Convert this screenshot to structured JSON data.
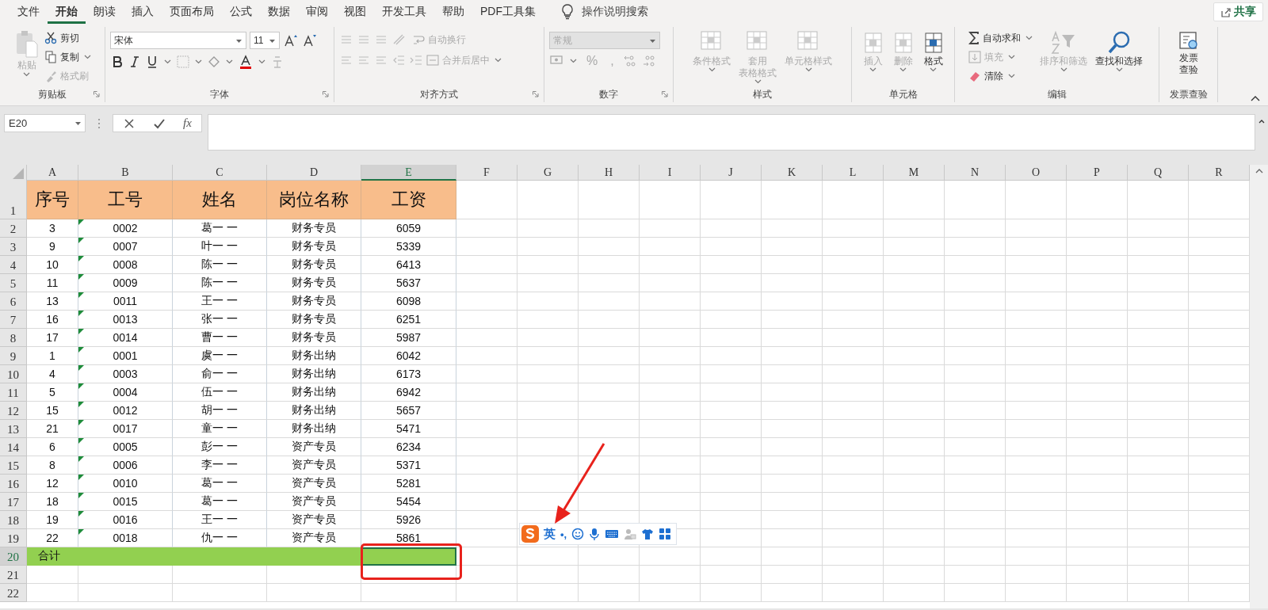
{
  "menu_tabs": [
    {
      "label": "文件",
      "selected": false
    },
    {
      "label": "开始",
      "selected": true
    },
    {
      "label": "朗读",
      "selected": false
    },
    {
      "label": "插入",
      "selected": false
    },
    {
      "label": "页面布局",
      "selected": false
    },
    {
      "label": "公式",
      "selected": false
    },
    {
      "label": "数据",
      "selected": false
    },
    {
      "label": "审阅",
      "selected": false
    },
    {
      "label": "视图",
      "selected": false
    },
    {
      "label": "开发工具",
      "selected": false
    },
    {
      "label": "帮助",
      "selected": false
    },
    {
      "label": "PDF工具集",
      "selected": false
    }
  ],
  "tell_me": "操作说明搜索",
  "share_button": "共享",
  "ribbon": {
    "clipboard": {
      "label": "剪贴板",
      "paste": "粘贴",
      "cut": "剪切",
      "copy": "复制",
      "format_painter": "格式刷"
    },
    "font": {
      "label": "字体",
      "font_name": "宋体",
      "font_size": "11"
    },
    "alignment": {
      "label": "对齐方式",
      "wrap": "自动换行",
      "merge": "合并后居中"
    },
    "number": {
      "label": "数字",
      "format": "常规",
      "percent": "%",
      "comma": ","
    },
    "styles": {
      "label": "样式",
      "buttons": [
        {
          "lines": [
            "条件格式"
          ],
          "disabled": true
        },
        {
          "lines": [
            "套用",
            "表格格式"
          ],
          "disabled": true
        },
        {
          "lines": [
            "单元格样式"
          ],
          "disabled": true
        }
      ]
    },
    "cells": {
      "label": "单元格",
      "buttons": [
        {
          "lines": [
            "插入"
          ],
          "disabled": true
        },
        {
          "lines": [
            "删除"
          ],
          "disabled": true
        },
        {
          "lines": [
            "格式"
          ],
          "disabled": false
        }
      ]
    },
    "editing": {
      "label": "编辑",
      "autosum": "自动求和",
      "fill": "填充",
      "clear": "清除",
      "sort": "排序和筛选",
      "find": "查找和选择"
    },
    "invoice": {
      "label": "发票查验",
      "lines": [
        "发票",
        "查验"
      ]
    }
  },
  "formula_bar": {
    "name_box": "E20",
    "fx": "fx"
  },
  "sheet": {
    "columns": [
      {
        "label": "A",
        "selected": false
      },
      {
        "label": "B",
        "selected": false
      },
      {
        "label": "C",
        "selected": false
      },
      {
        "label": "D",
        "selected": false
      },
      {
        "label": "E",
        "selected": true
      },
      {
        "label": "F",
        "selected": false
      },
      {
        "label": "G",
        "selected": false
      },
      {
        "label": "H",
        "selected": false
      },
      {
        "label": "I",
        "selected": false
      },
      {
        "label": "J",
        "selected": false
      },
      {
        "label": "K",
        "selected": false
      },
      {
        "label": "L",
        "selected": false
      },
      {
        "label": "M",
        "selected": false
      },
      {
        "label": "N",
        "selected": false
      },
      {
        "label": "O",
        "selected": false
      },
      {
        "label": "P",
        "selected": false
      },
      {
        "label": "Q",
        "selected": false
      },
      {
        "label": "R",
        "selected": false
      }
    ],
    "rows": [
      {
        "number": "1",
        "kind": "header",
        "selected": false,
        "cells": [
          "序号",
          "工号",
          "姓名",
          "岗位名称",
          "工资"
        ]
      },
      {
        "number": "2",
        "kind": "data",
        "selected": false,
        "text_flag": true,
        "cells": [
          "3",
          "0002",
          "葛一 一",
          "财务专员",
          "6059"
        ]
      },
      {
        "number": "3",
        "kind": "data",
        "selected": false,
        "text_flag": true,
        "cells": [
          "9",
          "0007",
          "叶一 一",
          "财务专员",
          "5339"
        ]
      },
      {
        "number": "4",
        "kind": "data",
        "selected": false,
        "text_flag": true,
        "cells": [
          "10",
          "0008",
          "陈一 一",
          "财务专员",
          "6413"
        ]
      },
      {
        "number": "5",
        "kind": "data",
        "selected": false,
        "text_flag": true,
        "cells": [
          "11",
          "0009",
          "陈一 一",
          "财务专员",
          "5637"
        ]
      },
      {
        "number": "6",
        "kind": "data",
        "selected": false,
        "text_flag": true,
        "cells": [
          "13",
          "0011",
          "王一 一",
          "财务专员",
          "6098"
        ]
      },
      {
        "number": "7",
        "kind": "data",
        "selected": false,
        "text_flag": true,
        "cells": [
          "16",
          "0013",
          "张一 一",
          "财务专员",
          "6251"
        ]
      },
      {
        "number": "8",
        "kind": "data",
        "selected": false,
        "text_flag": true,
        "cells": [
          "17",
          "0014",
          "曹一 一",
          "财务专员",
          "5987"
        ]
      },
      {
        "number": "9",
        "kind": "data",
        "selected": false,
        "text_flag": true,
        "cells": [
          "1",
          "0001",
          "虞一 一",
          "财务出纳",
          "6042"
        ]
      },
      {
        "number": "10",
        "kind": "data",
        "selected": false,
        "text_flag": true,
        "cells": [
          "4",
          "0003",
          "俞一 一",
          "财务出纳",
          "6173"
        ]
      },
      {
        "number": "11",
        "kind": "data",
        "selected": false,
        "text_flag": true,
        "cells": [
          "5",
          "0004",
          "伍一 一",
          "财务出纳",
          "6942"
        ]
      },
      {
        "number": "12",
        "kind": "data",
        "selected": false,
        "text_flag": true,
        "cells": [
          "15",
          "0012",
          "胡一 一",
          "财务出纳",
          "5657"
        ]
      },
      {
        "number": "13",
        "kind": "data",
        "selected": false,
        "text_flag": true,
        "cells": [
          "21",
          "0017",
          "童一 一",
          "财务出纳",
          "5471"
        ]
      },
      {
        "number": "14",
        "kind": "data",
        "selected": false,
        "text_flag": true,
        "cells": [
          "6",
          "0005",
          "彭一 一",
          "资产专员",
          "6234"
        ]
      },
      {
        "number": "15",
        "kind": "data",
        "selected": false,
        "text_flag": true,
        "cells": [
          "8",
          "0006",
          "李一 一",
          "资产专员",
          "5371"
        ]
      },
      {
        "number": "16",
        "kind": "data",
        "selected": false,
        "text_flag": true,
        "cells": [
          "12",
          "0010",
          "葛一 一",
          "资产专员",
          "5281"
        ]
      },
      {
        "number": "17",
        "kind": "data",
        "selected": false,
        "text_flag": true,
        "cells": [
          "18",
          "0015",
          "葛一 一",
          "资产专员",
          "5454"
        ]
      },
      {
        "number": "18",
        "kind": "data",
        "selected": false,
        "text_flag": true,
        "cells": [
          "19",
          "0016",
          "王一 一",
          "资产专员",
          "5926"
        ]
      },
      {
        "number": "19",
        "kind": "data",
        "selected": false,
        "text_flag": true,
        "cells": [
          "22",
          "0018",
          "仇一 一",
          "资产专员",
          "5861"
        ]
      },
      {
        "number": "20",
        "kind": "total",
        "selected": true,
        "cells": [
          "合计"
        ]
      },
      {
        "number": "21",
        "kind": "empty",
        "selected": false,
        "cells": []
      },
      {
        "number": "22",
        "kind": "empty",
        "selected": false,
        "cells": []
      }
    ]
  },
  "ime_toolbar": {
    "mode": "英",
    "punctuation": "•,"
  }
}
